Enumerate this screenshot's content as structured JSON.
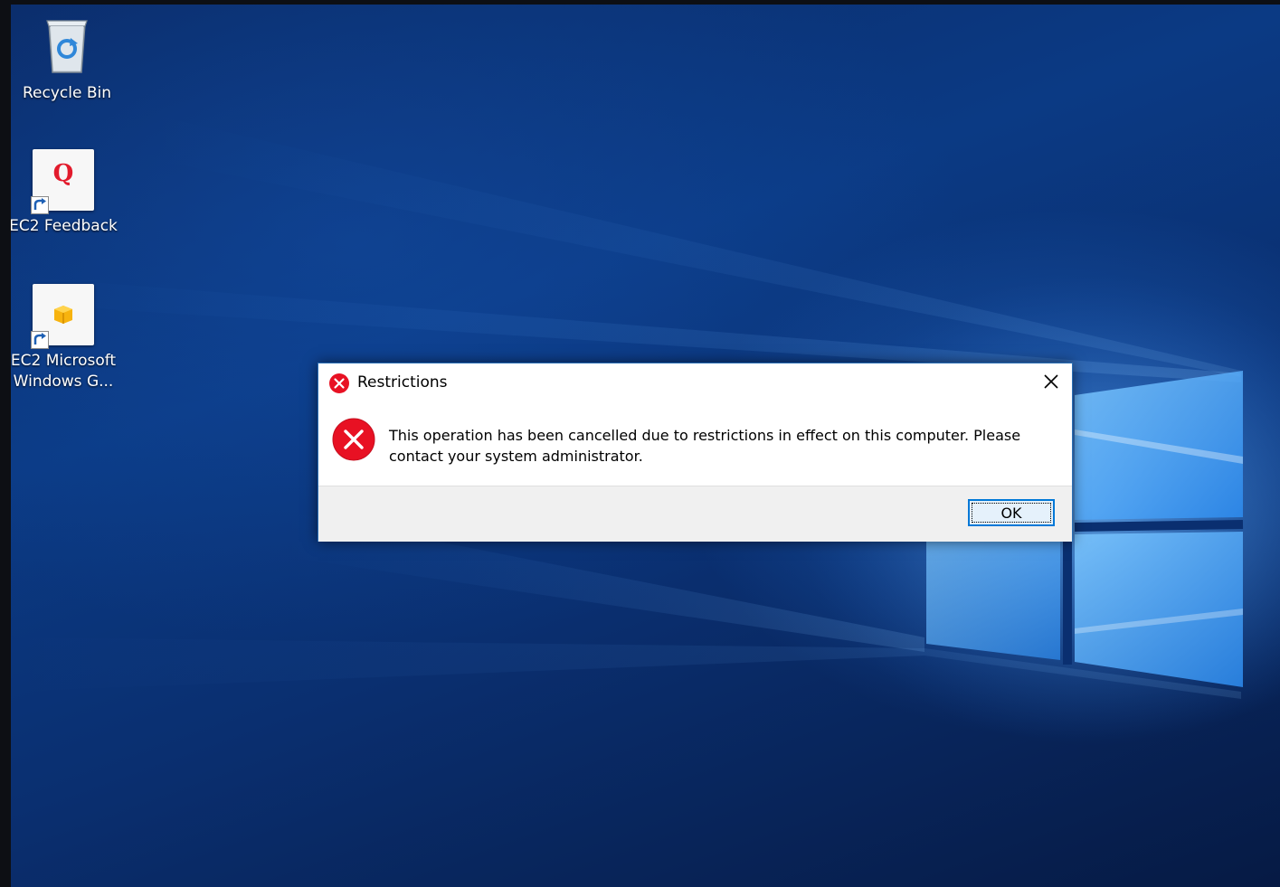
{
  "desktop": {
    "icons": [
      {
        "label": "Recycle Bin",
        "icon": "recycle-bin-icon"
      },
      {
        "label": "EC2 Feedback",
        "icon": "ec2-feedback-icon",
        "glyph": "Q"
      },
      {
        "label": "EC2 Microsoft Windows G...",
        "label_line1": "EC2 Microsoft",
        "label_line2": "Windows G...",
        "icon": "ec2-windows-guide-icon"
      }
    ]
  },
  "dialog": {
    "title": "Restrictions",
    "title_icon": "error-icon",
    "message": "This operation has been cancelled due to restrictions in effect on this computer. Please contact your system administrator.",
    "message_icon": "error-icon",
    "ok_label": "OK",
    "close_icon": "close-icon"
  },
  "colors": {
    "error_red": "#e81123",
    "accent_blue": "#0078d7",
    "wallpaper_blue": "#0b3a84"
  }
}
